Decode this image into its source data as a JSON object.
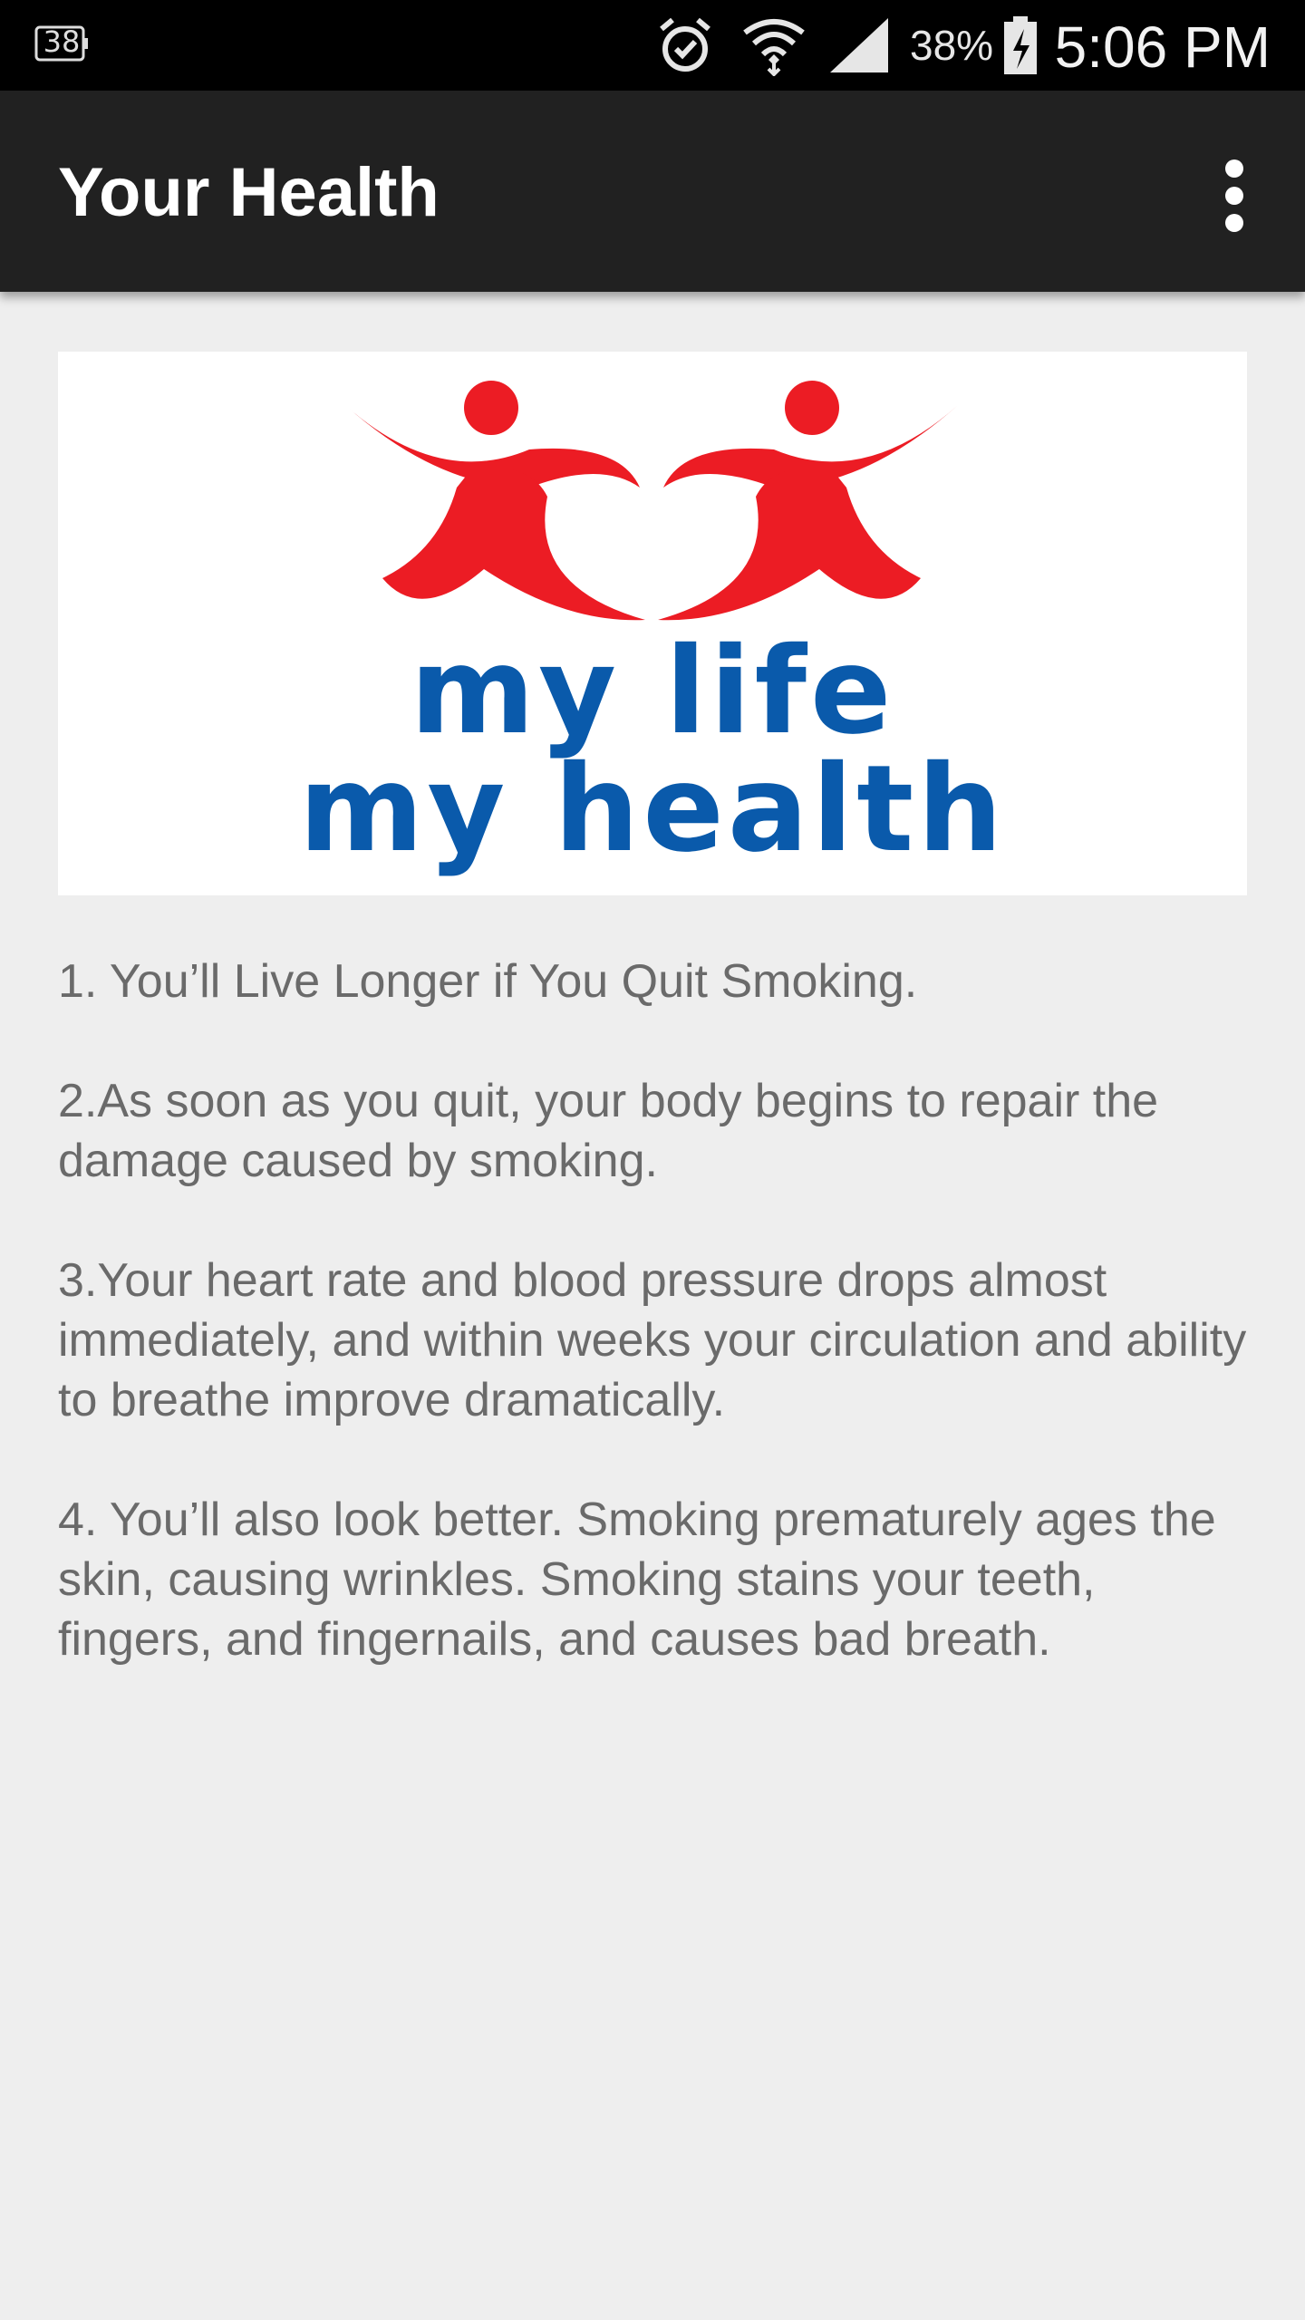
{
  "status_bar": {
    "notification_badge": "38",
    "icons": [
      "alarm-icon",
      "wifi-icon",
      "signal-icon",
      "battery-charging-icon"
    ],
    "battery_percent": "38%",
    "time": "5:06 PM"
  },
  "app_bar": {
    "title": "Your Health",
    "overflow_icon": "more-vert-icon"
  },
  "hero": {
    "logo_line1": "my life",
    "logo_line2": "my health",
    "colors": {
      "figures": "#ec1c24",
      "text": "#0a5aab"
    }
  },
  "tips": [
    "1. You’ll Live Longer if You Quit Smoking.",
    "2.As soon as you quit, your body begins to repair the damage caused by smoking.",
    "3.Your heart rate and blood pressure drops almost immediately, and within weeks your circulation and ability to breathe improve dramatically.",
    "4. You’ll also look better. Smoking prematurely ages the skin, causing wrinkles. Smoking stains your teeth, fingers, and fingernails, and causes bad breath."
  ]
}
